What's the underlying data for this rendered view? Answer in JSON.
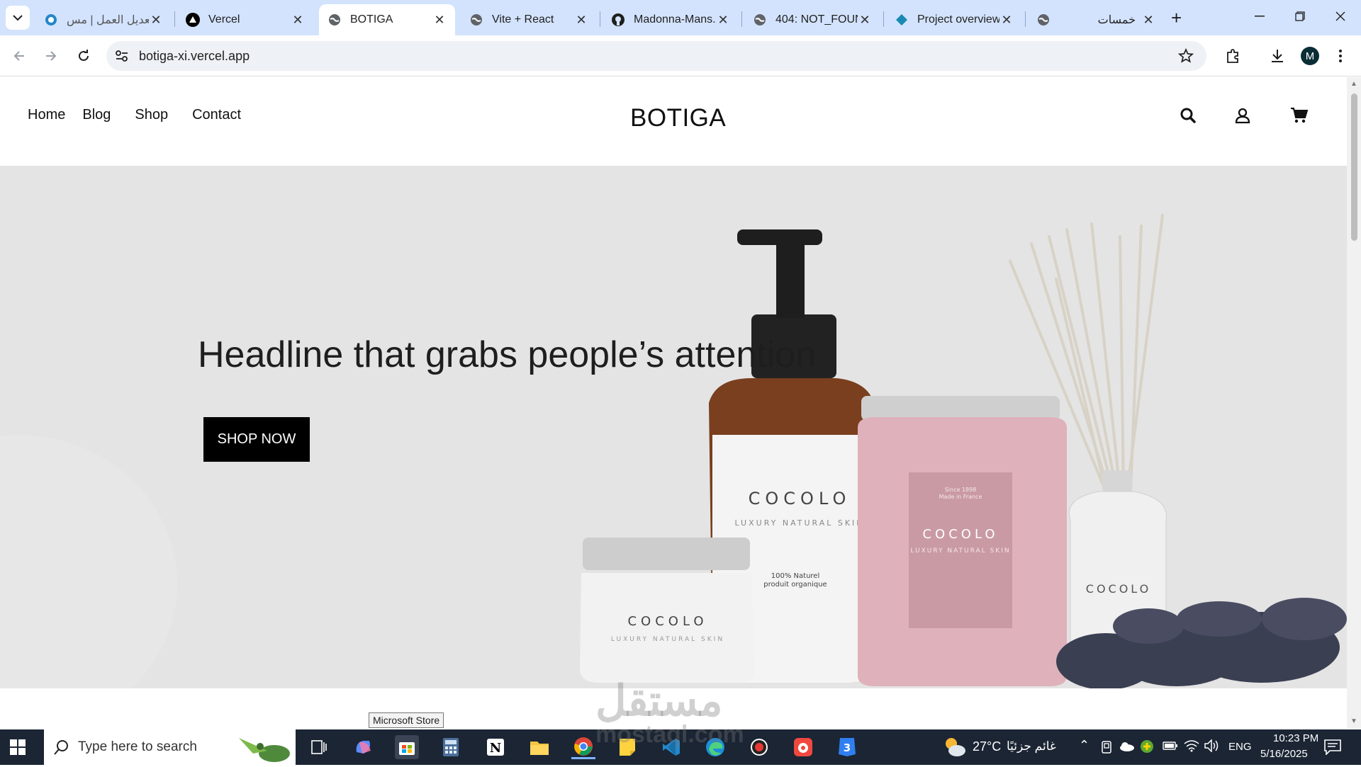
{
  "browser": {
    "tabs": [
      {
        "title": "تعديل العمل | مس...",
        "icon": "mostaql-icon"
      },
      {
        "title": "Vercel",
        "icon": "vercel-icon"
      },
      {
        "title": "BOTIGA",
        "icon": "globe-icon"
      },
      {
        "title": "Vite + React",
        "icon": "globe-icon"
      },
      {
        "title": "Madonna-Mans...",
        "icon": "github-icon"
      },
      {
        "title": "404: NOT_FOUN...",
        "icon": "globe-icon"
      },
      {
        "title": "Project overview",
        "icon": "firebase-icon"
      },
      {
        "title": "خمسات",
        "icon": "globe-icon"
      }
    ],
    "url": "botiga-xi.vercel.app",
    "profile_initial": "M"
  },
  "site": {
    "nav": [
      "Home",
      "Blog",
      "Shop",
      "Contact"
    ],
    "brand": "BOTIGA",
    "hero": {
      "headline": "Headline that grabs people’s attention",
      "cta": "SHOP NOW",
      "product_labels": {
        "brand": "COCOLO",
        "tagline": "LUXURY NATURAL SKIN",
        "bottle_note": "100% Naturel",
        "bottle_note2": "produit organique",
        "jar_note": "Since 1898",
        "jar_note2": "Made in France"
      }
    }
  },
  "tooltip": "Microsoft Store",
  "watermark": {
    "ar": "مستقل",
    "en": "mostaql.com"
  },
  "taskbar": {
    "search_placeholder": "Type here to search",
    "weather": "27°C",
    "weather_text": "غائم جزئيًا",
    "lang": "ENG",
    "time": "10:23 PM",
    "date": "5/16/2025"
  }
}
